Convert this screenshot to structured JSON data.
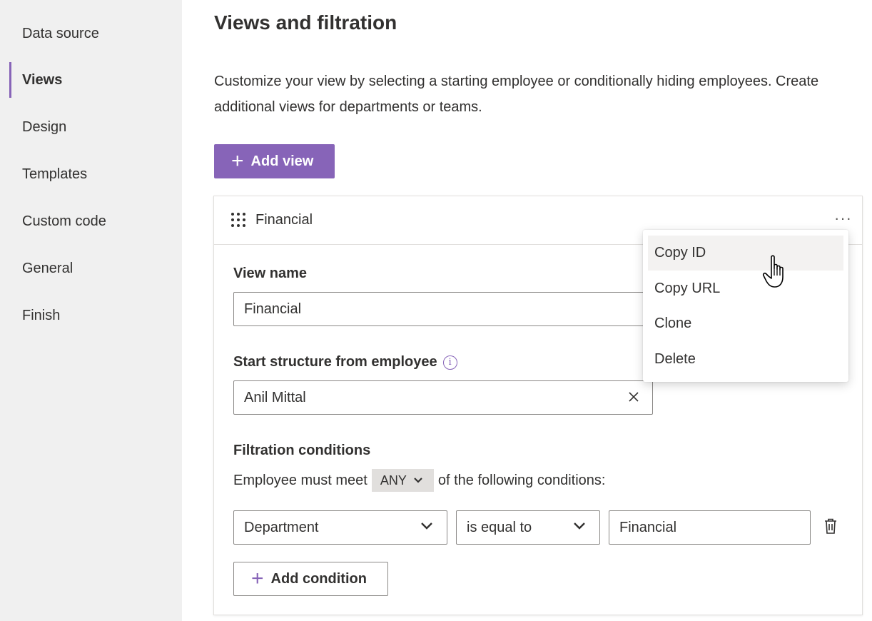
{
  "sidebar": {
    "items": [
      {
        "label": "Data source",
        "active": false
      },
      {
        "label": "Views",
        "active": true
      },
      {
        "label": "Design",
        "active": false
      },
      {
        "label": "Templates",
        "active": false
      },
      {
        "label": "Custom code",
        "active": false
      },
      {
        "label": "General",
        "active": false
      },
      {
        "label": "Finish",
        "active": false
      }
    ]
  },
  "main": {
    "title": "Views and filtration",
    "description": "Customize your view by selecting a starting employee or conditionally hiding employees. Create additional views for departments or teams.",
    "add_view_label": "Add view"
  },
  "view_card": {
    "title": "Financial",
    "view_name_label": "View name",
    "view_name_value": "Financial",
    "start_label": "Start structure from employee",
    "start_value": "Anil Mittal",
    "filtration_label": "Filtration conditions",
    "condition_prefix": "Employee must meet",
    "condition_mode": "ANY",
    "condition_suffix": "of the following conditions:",
    "condition": {
      "field": "Department",
      "operator": "is equal to",
      "value": "Financial"
    },
    "add_condition_label": "Add condition"
  },
  "context_menu": {
    "items": [
      "Copy ID",
      "Copy URL",
      "Clone",
      "Delete"
    ],
    "hovered": "Copy ID"
  },
  "colors": {
    "accent": "#8764b8",
    "sidebar_bg": "#f0f0f0",
    "text": "#323130"
  }
}
